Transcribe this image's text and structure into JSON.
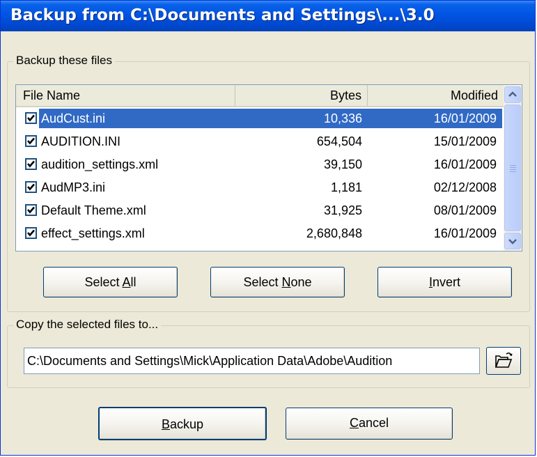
{
  "window": {
    "title": "Backup from C:\\Documents and Settings\\...\\3.0"
  },
  "files_group": {
    "legend": "Backup these files",
    "columns": [
      "File Name",
      "Bytes",
      "Modified"
    ],
    "rows": [
      {
        "name": "AudCust.ini",
        "bytes": "10,336",
        "modified": "16/01/2009",
        "checked": true,
        "selected": true
      },
      {
        "name": "AUDITION.INI",
        "bytes": "654,504",
        "modified": "15/01/2009",
        "checked": true,
        "selected": false
      },
      {
        "name": "audition_settings.xml",
        "bytes": "39,150",
        "modified": "16/01/2009",
        "checked": true,
        "selected": false
      },
      {
        "name": "AudMP3.ini",
        "bytes": "1,181",
        "modified": "02/12/2008",
        "checked": true,
        "selected": false
      },
      {
        "name": "Default Theme.xml",
        "bytes": "31,925",
        "modified": "08/01/2009",
        "checked": true,
        "selected": false
      },
      {
        "name": "effect_settings.xml",
        "bytes": "2,680,848",
        "modified": "16/01/2009",
        "checked": true,
        "selected": false
      }
    ],
    "buttons": {
      "select_all": {
        "pre": "Select ",
        "key": "A",
        "post": "ll"
      },
      "select_none": {
        "pre": "Select ",
        "key": "N",
        "post": "one"
      },
      "invert": {
        "pre": "",
        "key": "I",
        "post": "nvert"
      }
    }
  },
  "copy_group": {
    "legend": "Copy the selected files to...",
    "path": "C:\\Documents and Settings\\Mick\\Application Data\\Adobe\\Audition"
  },
  "actions": {
    "backup": {
      "pre": "",
      "key": "B",
      "post": "ackup"
    },
    "cancel": {
      "pre": "",
      "key": "C",
      "post": "ancel"
    }
  },
  "icons": {
    "checkbox": "checkmark-icon",
    "scroll_up": "chevron-up-icon",
    "scroll_down": "chevron-down-icon",
    "browse": "open-folder-icon"
  },
  "colors": {
    "titlebar": "#0054e3",
    "selection": "#316ac5",
    "dialog_bg": "#ece9d8"
  }
}
